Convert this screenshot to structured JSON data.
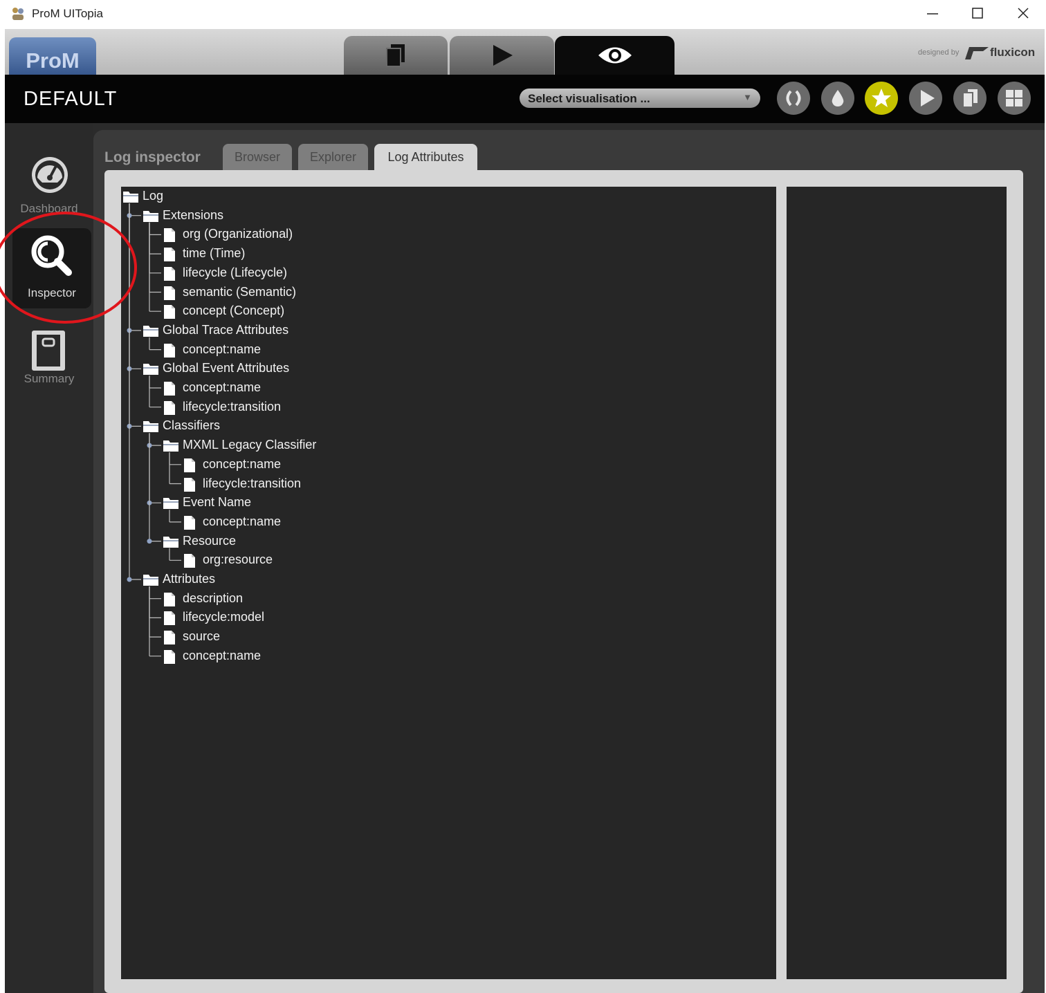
{
  "window": {
    "title": "ProM UITopia"
  },
  "app": {
    "logo": "ProM",
    "modes": [
      {
        "name": "workspace",
        "icon": "stacked-documents-icon"
      },
      {
        "name": "actions",
        "icon": "play-icon"
      },
      {
        "name": "views",
        "icon": "eye-icon",
        "active": true
      }
    ],
    "designed_by": "designed by",
    "brand": "fluxicon"
  },
  "header": {
    "workspace_name": "DEFAULT",
    "visualisation_select": {
      "value": "Select visualisation ..."
    },
    "buttons": [
      {
        "icon": "refresh-icon"
      },
      {
        "icon": "drop-icon"
      },
      {
        "icon": "star-icon",
        "color": "#c6c200"
      },
      {
        "icon": "play-icon"
      },
      {
        "icon": "copy-icon"
      },
      {
        "icon": "grid-icon"
      }
    ]
  },
  "sidebar": {
    "items": [
      {
        "label": "Dashboard",
        "icon": "gauge-icon"
      },
      {
        "label": "Inspector",
        "icon": "magnifier-icon",
        "active": true
      },
      {
        "label": "Summary",
        "icon": "notebook-icon"
      }
    ]
  },
  "inspector": {
    "title": "Log inspector",
    "tabs": [
      {
        "label": "Browser"
      },
      {
        "label": "Explorer"
      },
      {
        "label": "Log Attributes",
        "active": true
      }
    ]
  },
  "tree": [
    {
      "label": "Log",
      "type": "folder",
      "depth": 0
    },
    {
      "label": "Extensions",
      "type": "folder",
      "depth": 1
    },
    {
      "label": "org (Organizational)",
      "type": "leaf",
      "depth": 2
    },
    {
      "label": "time (Time)",
      "type": "leaf",
      "depth": 2
    },
    {
      "label": "lifecycle (Lifecycle)",
      "type": "leaf",
      "depth": 2
    },
    {
      "label": "semantic (Semantic)",
      "type": "leaf",
      "depth": 2
    },
    {
      "label": "concept (Concept)",
      "type": "leaf",
      "depth": 2
    },
    {
      "label": "Global Trace Attributes",
      "type": "folder",
      "depth": 1
    },
    {
      "label": "concept:name",
      "type": "leaf",
      "depth": 2
    },
    {
      "label": "Global Event Attributes",
      "type": "folder",
      "depth": 1
    },
    {
      "label": "concept:name",
      "type": "leaf",
      "depth": 2
    },
    {
      "label": "lifecycle:transition",
      "type": "leaf",
      "depth": 2
    },
    {
      "label": "Classifiers",
      "type": "folder",
      "depth": 1
    },
    {
      "label": "MXML Legacy Classifier",
      "type": "folder",
      "depth": 2
    },
    {
      "label": "concept:name",
      "type": "leaf",
      "depth": 3
    },
    {
      "label": "lifecycle:transition",
      "type": "leaf",
      "depth": 3
    },
    {
      "label": "Event Name",
      "type": "folder",
      "depth": 2
    },
    {
      "label": "concept:name",
      "type": "leaf",
      "depth": 3
    },
    {
      "label": "Resource",
      "type": "folder",
      "depth": 2
    },
    {
      "label": "org:resource",
      "type": "leaf",
      "depth": 3
    },
    {
      "label": "Attributes",
      "type": "folder",
      "depth": 1
    },
    {
      "label": "description",
      "type": "leaf",
      "depth": 2
    },
    {
      "label": "lifecycle:model",
      "type": "leaf",
      "depth": 2
    },
    {
      "label": "source",
      "type": "leaf",
      "depth": 2
    },
    {
      "label": "concept:name",
      "type": "leaf",
      "depth": 2
    }
  ]
}
